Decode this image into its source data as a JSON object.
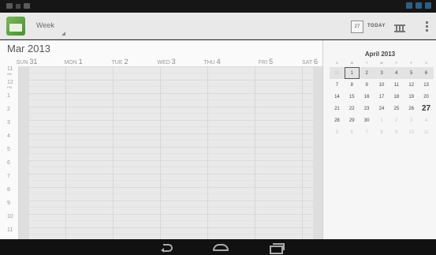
{
  "actionbar": {
    "view_label": "Week",
    "today_icon_date": "27",
    "today_label": "TODAY"
  },
  "week": {
    "month_title": "Mar 2013",
    "days": [
      {
        "dow": "SUN",
        "num": "31"
      },
      {
        "dow": "MON",
        "num": "1"
      },
      {
        "dow": "TUE",
        "num": "2"
      },
      {
        "dow": "WED",
        "num": "3"
      },
      {
        "dow": "THU",
        "num": "4"
      },
      {
        "dow": "FRI",
        "num": "5"
      },
      {
        "dow": "SAT",
        "num": "6"
      }
    ],
    "hours": [
      {
        "h": "11",
        "ampm": "AM"
      },
      {
        "h": "12",
        "ampm": "PM"
      },
      {
        "h": "1",
        "ampm": ""
      },
      {
        "h": "2",
        "ampm": ""
      },
      {
        "h": "3",
        "ampm": ""
      },
      {
        "h": "4",
        "ampm": ""
      },
      {
        "h": "5",
        "ampm": ""
      },
      {
        "h": "6",
        "ampm": ""
      },
      {
        "h": "7",
        "ampm": ""
      },
      {
        "h": "8",
        "ampm": ""
      },
      {
        "h": "9",
        "ampm": ""
      },
      {
        "h": "10",
        "ampm": ""
      },
      {
        "h": "11",
        "ampm": ""
      }
    ]
  },
  "mini": {
    "title": "April 2013",
    "dow": [
      "S",
      "M",
      "T",
      "W",
      "T",
      "F",
      "S"
    ],
    "rows": [
      [
        "31",
        "1",
        "2",
        "3",
        "4",
        "5",
        "6"
      ],
      [
        "7",
        "8",
        "9",
        "10",
        "11",
        "12",
        "13"
      ],
      [
        "14",
        "15",
        "16",
        "17",
        "18",
        "19",
        "20"
      ],
      [
        "21",
        "22",
        "23",
        "24",
        "25",
        "26",
        "27"
      ],
      [
        "28",
        "29",
        "30",
        "1",
        "2",
        "3",
        "4"
      ],
      [
        "5",
        "6",
        "7",
        "8",
        "9",
        "10",
        "11"
      ]
    ]
  }
}
